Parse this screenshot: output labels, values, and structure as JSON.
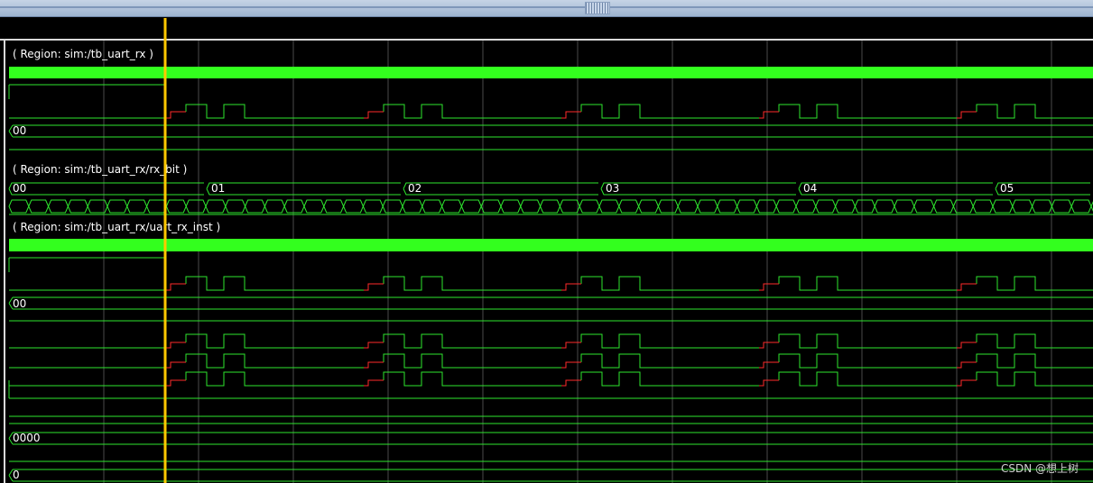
{
  "regions": [
    "( Region: sim:/tb_uart_rx )",
    "( Region: sim:/tb_uart_rx/rx_bit )",
    "( Region: sim:/tb_uart_rx/uart_rx_inst )"
  ],
  "bus_values": {
    "rx_data_1": "00",
    "rx_bit": [
      "00",
      "01",
      "02",
      "03",
      "04",
      "05"
    ],
    "rx_data_2": "00",
    "counter": "0000",
    "flag": "0"
  },
  "watermark": "CSDN @想上树",
  "colors": {
    "wave": "#2ee62e",
    "green_bar": "#33ff1e",
    "grid": "#4a4a4a",
    "cursor": "#ffc800",
    "red_transition": "#ff2a2a",
    "background": "#000000"
  }
}
